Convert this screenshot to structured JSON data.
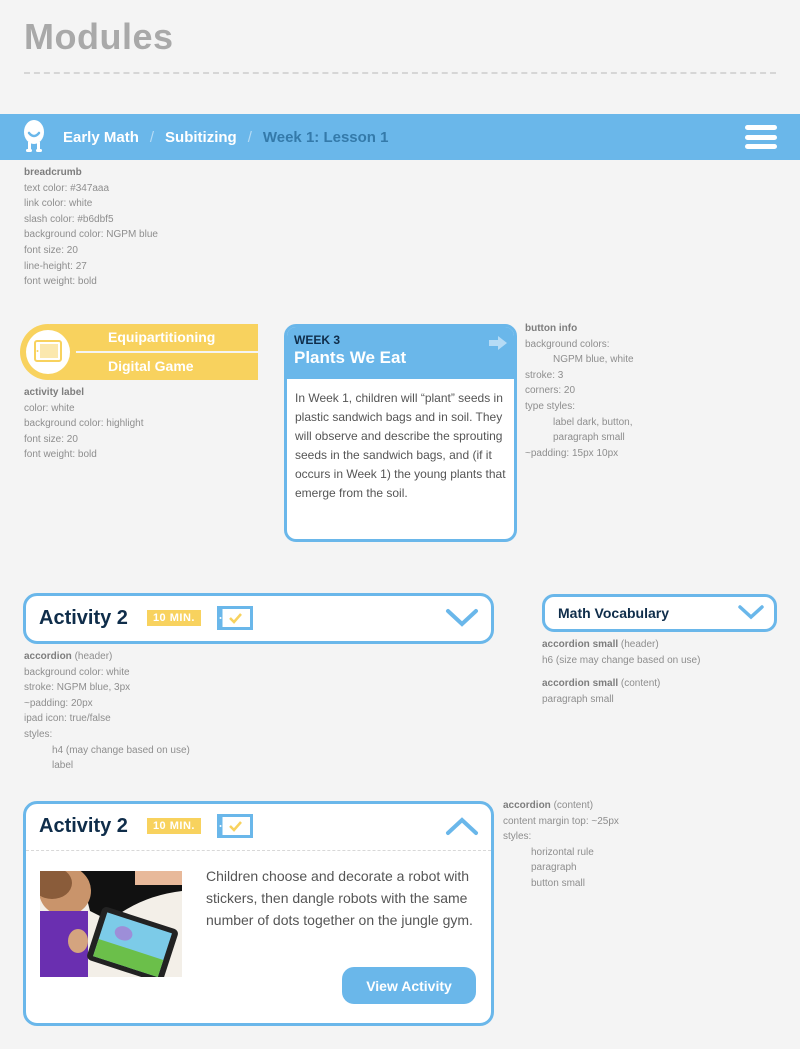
{
  "page_title": "Modules",
  "breadcrumb": {
    "items": [
      {
        "label": "Early Math",
        "type": "link"
      },
      {
        "label": "Subitizing",
        "type": "link"
      },
      {
        "label": "Week 1: Lesson 1",
        "type": "current"
      }
    ],
    "separator": "/",
    "colors": {
      "background": "#6ab7ea",
      "text": "#347aaa",
      "link": "#ffffff",
      "slash": "#b6dbf5"
    },
    "notes": {
      "heading": "breadcrumb",
      "lines": [
        "text color: #347aaa",
        "link color: white",
        "slash color: #b6dbf5",
        "background color: NGPM blue",
        "font size: 20",
        "line-height: 27",
        "font weight: bold"
      ]
    }
  },
  "activity_label": {
    "line1": "Equipartitioning",
    "line2": "Digital Game",
    "icon": "tablet-icon",
    "color": "#f8d25e",
    "notes": {
      "heading": "activity label",
      "lines": [
        "color: white",
        "background color: highlight",
        "font size: 20",
        "font weight: bold"
      ]
    }
  },
  "week_card": {
    "kicker": "WEEK 3",
    "title": "Plants We Eat",
    "icon": "arrow-right-icon",
    "body": "In Week 1, children will “plant” seeds in plastic sandwich bags and in soil. They will observe and describe the sprouting seeds in the sandwich bags, and (if it occurs in Week 1) the young plants that emerge from the soil."
  },
  "button_info": {
    "heading": "button info",
    "lines": [
      {
        "text": "background colors:",
        "indent": false
      },
      {
        "text": "NGPM blue, white",
        "indent": true
      },
      {
        "text": "stroke: 3",
        "indent": false
      },
      {
        "text": "corners: 20",
        "indent": false
      },
      {
        "text": "type styles:",
        "indent": false
      },
      {
        "text": "label dark, button,",
        "indent": true
      },
      {
        "text": "paragraph small",
        "indent": true
      },
      {
        "text": "~padding: 15px 10px",
        "indent": false
      }
    ]
  },
  "accordion_collapsed": {
    "title": "Activity 2",
    "duration": "10 MIN.",
    "ipad_icon": true,
    "chevron": "chevron-down-icon",
    "notes": {
      "heading": "accordion",
      "heading_suffix": " (header)",
      "lines": [
        "background color: white",
        "stroke: NGPM blue, 3px",
        "~padding: 20px",
        "ipad icon: true/false",
        "styles:"
      ],
      "indented": [
        "h4 (may change based on use)",
        "label"
      ]
    }
  },
  "accordion_small": {
    "title": "Math Vocabulary",
    "chevron": "chevron-down-icon",
    "notes": {
      "header_heading": "accordion small",
      "header_suffix": " (header)",
      "header_line": "h6 (size may change based on use)",
      "content_heading": "accordion small",
      "content_suffix": " (content)",
      "content_line": "paragraph small"
    }
  },
  "accordion_expanded": {
    "title": "Activity 2",
    "duration": "10 MIN.",
    "ipad_icon": true,
    "chevron": "chevron-up-icon",
    "paragraph": "Children choose and decorate a robot with stickers, then dangle robots with the same number of dots together on the jungle gym.",
    "button_label": "View Activity",
    "photo_alt": "Child playing a digital game on a tablet",
    "notes": {
      "heading": "accordion",
      "heading_suffix": " (content)",
      "lines": [
        "content margin top: ~25px",
        "styles:"
      ],
      "indented": [
        "horizontal rule",
        "paragraph",
        "button small"
      ]
    }
  },
  "colors": {
    "ngpm_blue": "#6ab7ea",
    "highlight": "#f8d25e",
    "dark_label": "#0f2d4a"
  }
}
